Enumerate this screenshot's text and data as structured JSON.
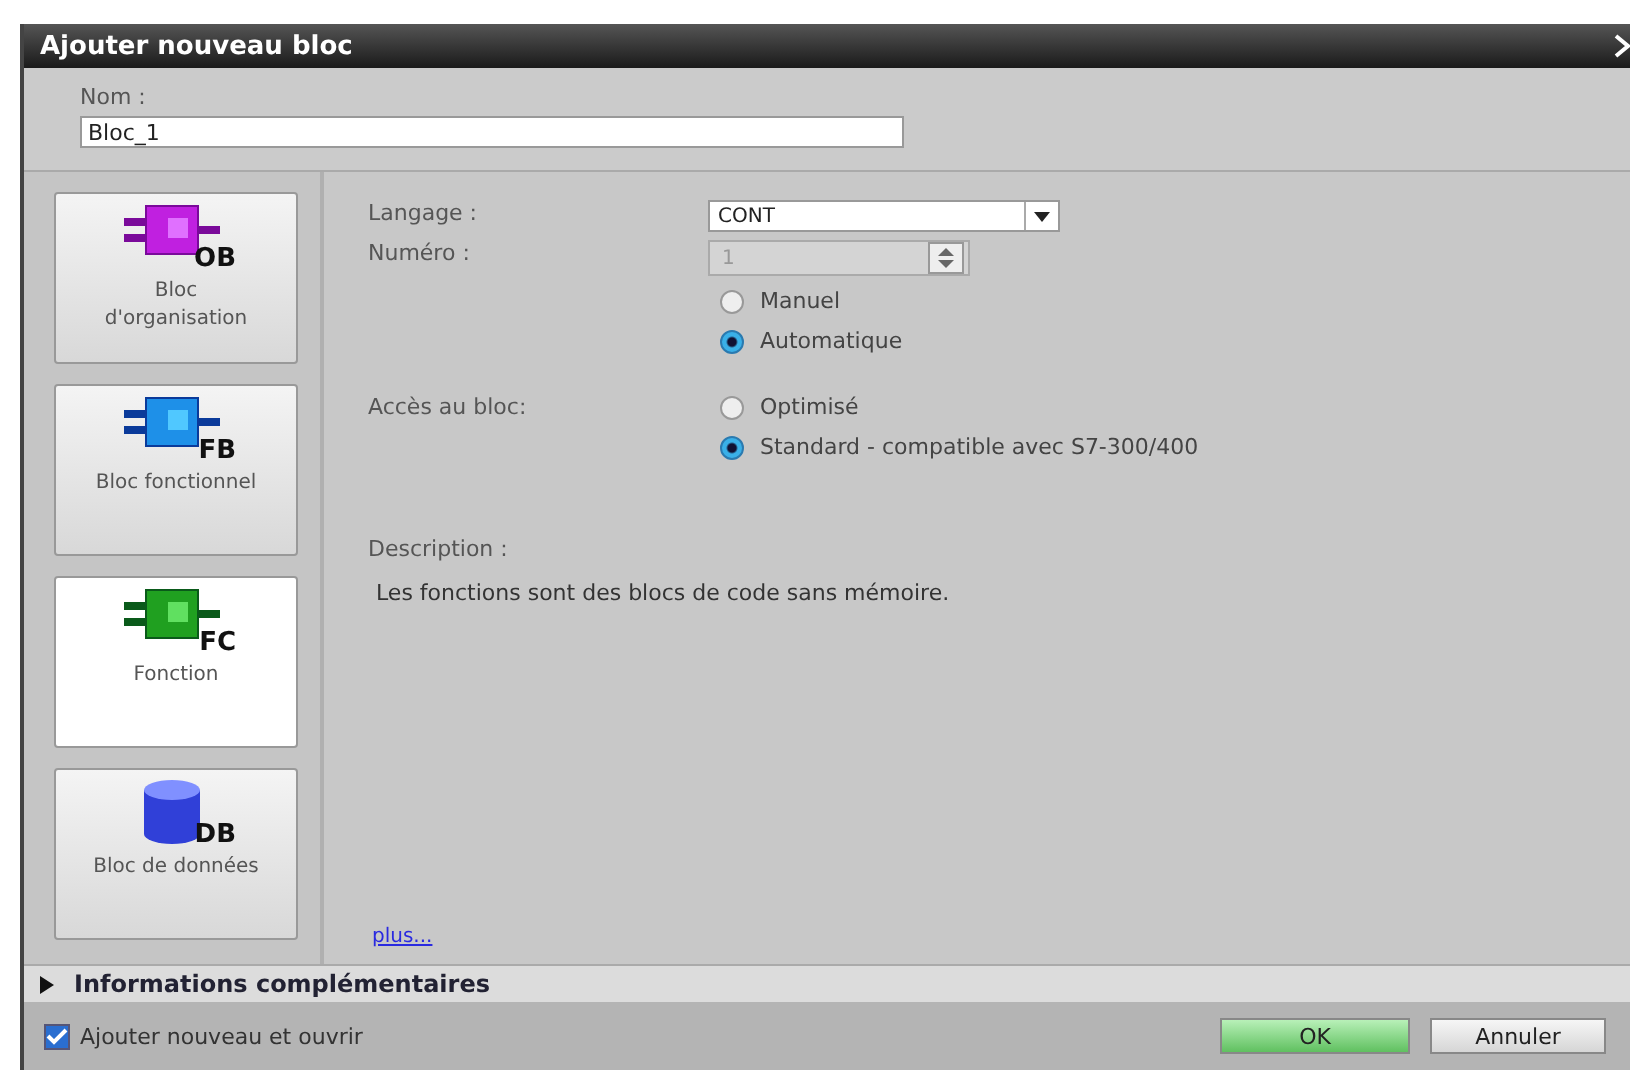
{
  "window": {
    "title": "Ajouter nouveau bloc"
  },
  "name_field": {
    "label": "Nom :",
    "value": "Bloc_1"
  },
  "block_types": [
    {
      "kind": "ob",
      "code": "OB",
      "label": "Bloc d'organisation",
      "selected": false
    },
    {
      "kind": "fb",
      "code": "FB",
      "label": "Bloc fonctionnel",
      "selected": false
    },
    {
      "kind": "fc",
      "code": "FC",
      "label": "Fonction",
      "selected": true
    },
    {
      "kind": "db",
      "code": "DB",
      "label": "Bloc de données",
      "selected": false
    }
  ],
  "language": {
    "label": "Langage :",
    "value": "CONT"
  },
  "number": {
    "label": "Numéro :",
    "value": "1",
    "disabled": true,
    "options": [
      {
        "label": "Manuel",
        "selected": false
      },
      {
        "label": "Automatique",
        "selected": true
      }
    ]
  },
  "access": {
    "label": "Accès au bloc:",
    "options": [
      {
        "label": "Optimisé",
        "selected": false
      },
      {
        "label": "Standard - compatible avec S7-300/400",
        "selected": true
      }
    ]
  },
  "description": {
    "label": "Description :",
    "text": "Les fonctions sont des blocs de code sans mémoire."
  },
  "more_link": "plus...",
  "more_info": {
    "label": "Informations complémentaires",
    "expanded": false
  },
  "add_and_open": {
    "label": "Ajouter nouveau et ouvrir",
    "checked": true
  },
  "buttons": [
    {
      "label": "OK",
      "kind": "primary"
    },
    {
      "label": "Annuler",
      "kind": "secondary"
    }
  ]
}
